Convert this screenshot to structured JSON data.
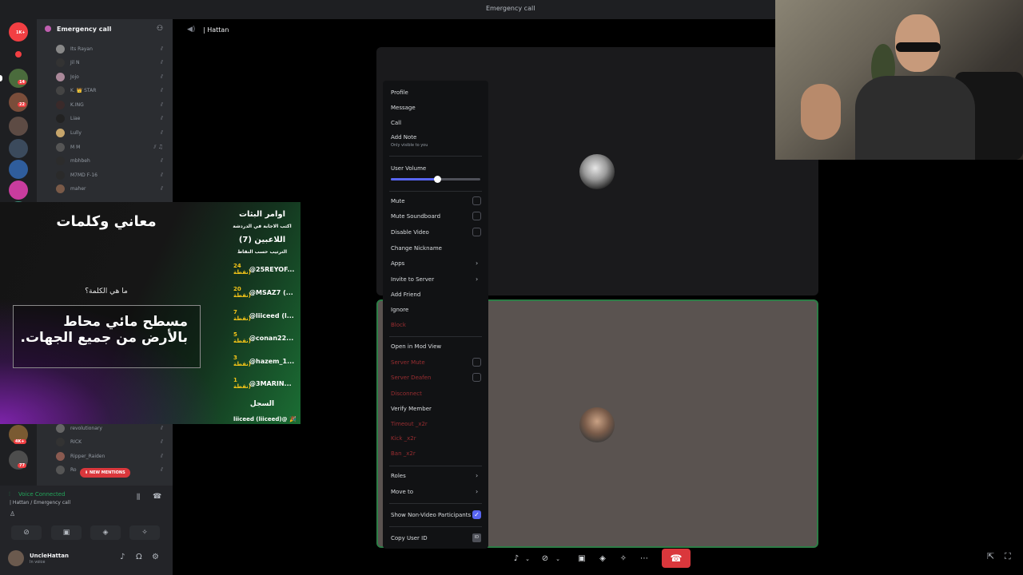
{
  "window": {
    "title": "Emergency call"
  },
  "server_rail": {
    "badges": [
      "14",
      "22",
      "4K+",
      "77"
    ],
    "logo_badge": "1K+"
  },
  "sidebar": {
    "channel_header": "Emergency call",
    "voice_users_top": [
      {
        "name": "Its Rayan"
      },
      {
        "name": "Jil N"
      },
      {
        "name": "Jojo"
      },
      {
        "name": "K. 👑 STAR"
      },
      {
        "name": "K.ING"
      },
      {
        "name": "Liae"
      },
      {
        "name": "Lully"
      },
      {
        "name": "M M"
      },
      {
        "name": "mbhbeh"
      },
      {
        "name": "M7MD F-16"
      },
      {
        "name": "maher"
      }
    ],
    "voice_users_bottom": [
      {
        "name": "revolutionary"
      },
      {
        "name": "RICK"
      },
      {
        "name": "Ripper_Raiden"
      },
      {
        "name": "Ro"
      }
    ],
    "new_mentions": "NEW MENTIONS"
  },
  "voice_panel": {
    "status": "Voice Connected",
    "location": "| Hattan / Emergency call"
  },
  "user_panel": {
    "name": "UncleHattan",
    "status": "In voice"
  },
  "main": {
    "channel_name": "| Hattan"
  },
  "game": {
    "title": "معاني وكلمات",
    "question": "ما هي الكلمة؟",
    "hint": "مسطح مائي محاط بالأرض من جميع الجهات.",
    "panel_title": "اوامر البثات",
    "panel_sub": "اكتب الاجابة في الدردشة",
    "players_title": "اللاعبين (7)",
    "players_sub": "الترتيب حسب النقاط",
    "players": [
      {
        "points": "24 نقطة)",
        "name": "@25REYOF..."
      },
      {
        "points": "20 نقطة)",
        "name": "@MSAZ7 (..."
      },
      {
        "points": "7 نقطة)",
        "name": "@liiceed (l..."
      },
      {
        "points": "5 نقطة)",
        "name": "@conan22..."
      },
      {
        "points": "3 نقطة)",
        "name": "@hazem_1..."
      },
      {
        "points": "1 نقطة)",
        "name": "@3MARIN..."
      }
    ],
    "log_title": "السجل",
    "log_entry": "liiceed (liiceed)@ 🎉"
  },
  "context_menu": {
    "profile": "Profile",
    "message": "Message",
    "call": "Call",
    "add_note": "Add Note",
    "add_note_sub": "Only visible to you",
    "user_volume": "User Volume",
    "user_volume_value": 0.52,
    "mute": "Mute",
    "mute_soundboard": "Mute Soundboard",
    "disable_video": "Disable Video",
    "change_nickname": "Change Nickname",
    "apps": "Apps",
    "invite_to_server": "Invite to Server",
    "add_friend": "Add Friend",
    "ignore": "Ignore",
    "block": "Block",
    "open_in_mod_view": "Open in Mod View",
    "server_mute": "Server Mute",
    "server_deafen": "Server Deafen",
    "disconnect": "Disconnect",
    "verify_member": "Verify Member",
    "timeout": "Timeout _x2r",
    "kick": "Kick _x2r",
    "ban": "Ban _x2r",
    "roles": "Roles",
    "move_to": "Move to",
    "show_non_video": "Show Non-Video Participants",
    "copy_user_id": "Copy User ID"
  },
  "colors": {
    "accent": "#5865f2",
    "danger": "#da373c",
    "connected": "#23a55a"
  }
}
